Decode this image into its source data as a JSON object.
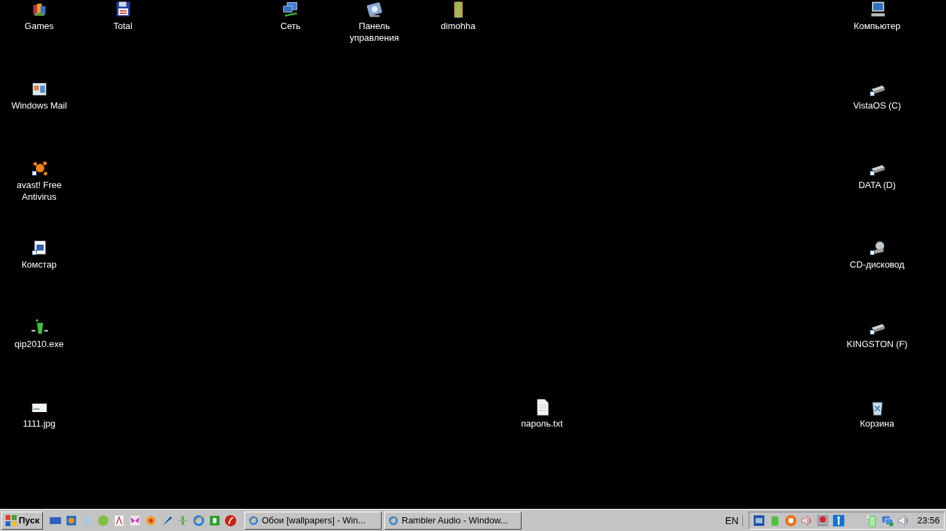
{
  "desktop_icons": [
    {
      "label": "Games"
    },
    {
      "label": "Total"
    },
    {
      "label": "Сеть"
    },
    {
      "label": "Панель управления"
    },
    {
      "label": "dimohha"
    },
    {
      "label": "Компьютер"
    },
    {
      "label": "Windows Mail"
    },
    {
      "label": "VistaOS (C)"
    },
    {
      "label": "avast! Free Antivirus"
    },
    {
      "label": "DATA (D)"
    },
    {
      "label": "Комстар"
    },
    {
      "label": "CD-дисковод"
    },
    {
      "label": "qip2010.exe"
    },
    {
      "label": "KINGSTON (F)"
    },
    {
      "label": "1111.jpg"
    },
    {
      "label": "пароль.txt"
    },
    {
      "label": "Корзина"
    }
  ],
  "taskbar": {
    "start_button": "Пуск",
    "tasks": [
      {
        "label": "Обои [wallpapers] - Win...",
        "selected": false
      },
      {
        "label": "Rambler Audio - Window...",
        "selected": false
      }
    ],
    "language": "EN",
    "clock": "23:56"
  }
}
